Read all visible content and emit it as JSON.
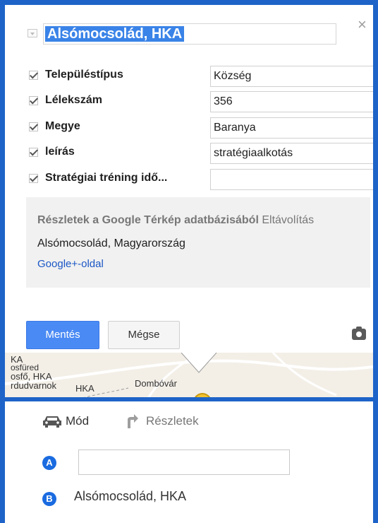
{
  "place": {
    "title": "Alsómocsolád, HKA",
    "close_symbol": "×"
  },
  "attributes": [
    {
      "label": "Településtípus",
      "value": "Község",
      "checked": true
    },
    {
      "label": "Lélekszám",
      "value": "356",
      "checked": true
    },
    {
      "label": "Megye",
      "value": "Baranya",
      "checked": true
    },
    {
      "label": "leírás",
      "value": "stratégiaalkotás",
      "checked": true
    },
    {
      "label": "Stratégiai tréning idő...",
      "value": "",
      "checked": true
    }
  ],
  "details": {
    "heading": "Részletek a Google Térkép adatbázisából",
    "remove_link": "Eltávolítás",
    "address": "Alsómocsolád, Magyarország",
    "gplus_link": "Google+-oldal"
  },
  "actions": {
    "save": "Mentés",
    "cancel": "Mégse",
    "camera_icon": "camera-icon"
  },
  "map": {
    "labels": [
      "KA",
      "osfüred",
      "osfő, HKA",
      "rdudvarnok",
      "HKA",
      "Dombóvár"
    ],
    "colors": {
      "road": "#f2c230",
      "land": "#f3efe7",
      "border": "#9a9a9a"
    }
  },
  "directions": {
    "mode_label": "Mód",
    "details_label": "Részletek",
    "origin_marker": "A",
    "origin_value": "",
    "destination_marker": "B",
    "destination_value": "Alsómocsolád, HKA"
  },
  "colors": {
    "frame": "#1e64c8",
    "primary_button": "#4a8af4",
    "link": "#1a56c5",
    "selection": "#3a83e8"
  }
}
